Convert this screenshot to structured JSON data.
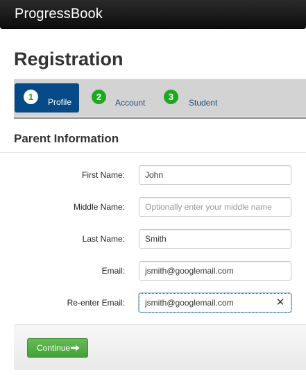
{
  "header": {
    "brand": "ProgressBook"
  },
  "page": {
    "title": "Registration"
  },
  "steps": [
    {
      "number": "1",
      "label": "Profile",
      "active": true
    },
    {
      "number": "2",
      "label": "Account",
      "active": false
    },
    {
      "number": "3",
      "label": "Student",
      "active": false
    }
  ],
  "section": {
    "title": "Parent Information"
  },
  "form": {
    "first_name": {
      "label": "First Name:",
      "value": "John",
      "placeholder": ""
    },
    "middle_name": {
      "label": "Middle Name:",
      "value": "",
      "placeholder": "Optionally enter your middle name"
    },
    "last_name": {
      "label": "Last Name:",
      "value": "Smith",
      "placeholder": ""
    },
    "email": {
      "label": "Email:",
      "value": "jsmith@googlemail.com",
      "placeholder": ""
    },
    "reenter_email": {
      "label": "Re-enter Email:",
      "value": "jsmith@googlemail.com",
      "placeholder": ""
    }
  },
  "actions": {
    "continue_label": "Continue"
  },
  "icons": {
    "clear": "close-icon",
    "continue": "arrow-right-icon"
  },
  "colors": {
    "topbar": "#111111",
    "active_step": "#054a87",
    "step_badge": "#1fa81f",
    "continue_button": "#55aa48"
  }
}
